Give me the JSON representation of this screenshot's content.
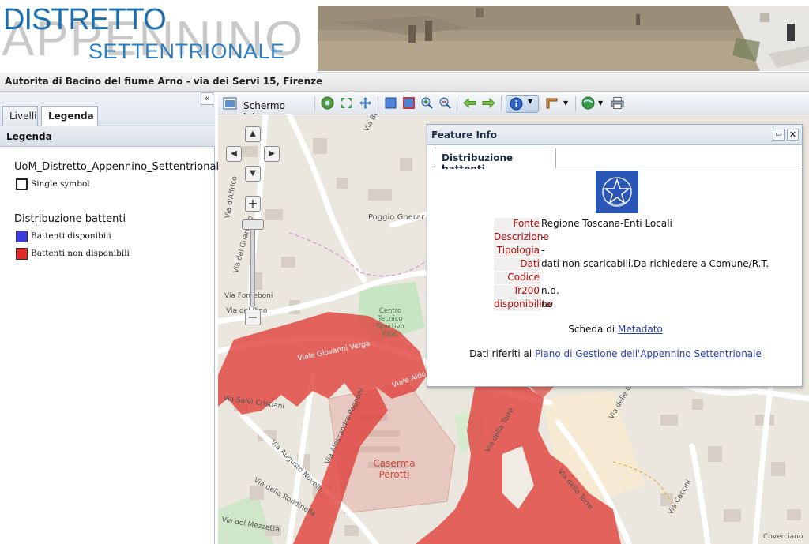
{
  "banner": {
    "logo_line1": "DISTRETTO",
    "logo_line2": "APPENNINO",
    "logo_line3": "SETTENTRIONALE"
  },
  "authority": {
    "text": "Autorita di Bacino del fiume Arno - via dei Servi 15, Firenze"
  },
  "left_panel": {
    "collapse_icon": "«",
    "tabs": [
      {
        "label": "Livelli",
        "active": false
      },
      {
        "label": "Legenda",
        "active": true
      }
    ],
    "header": "Legenda",
    "legend": [
      {
        "title": "UoM_Distretto_Appennino_Settentrionale",
        "items": [
          {
            "label": "Single symbol",
            "color": "#ffffff"
          }
        ]
      },
      {
        "title": "Distribuzione battenti",
        "items": [
          {
            "label": "Battenti disponibili",
            "color": "#3b3be0"
          },
          {
            "label": "Battenti non disponibili",
            "color": "#e02a2a"
          }
        ]
      }
    ]
  },
  "toolbar": {
    "full_extent_label": "Schermo Intero",
    "icons": [
      "full-extent-icon",
      "globe-zoom-icon",
      "zoom-extent-icon",
      "pan-icon",
      "zoom-box-in-icon",
      "zoom-box-out-icon",
      "zoom-in-icon",
      "zoom-out-icon",
      "previous-extent-icon",
      "next-extent-icon",
      "identify-info-icon",
      "measure-icon",
      "layers-globe-icon",
      "print-icon"
    ]
  },
  "map": {
    "labels": [
      "Poggio Gherar",
      "Centro Tecnico Sportivo FIGC",
      "Viale Giovanni Verga",
      "Viale Aldo Palazzeschi",
      "Via Salvi Cristiani",
      "Via Alessandro Pagnoni",
      "Via Augusto Novelli",
      "Via della Rondinella",
      "Via del Mezzetta",
      "Caserma Perotti",
      "Via della Torre",
      "Via della Torre",
      "Via delle Grazie",
      "Via Caccini",
      "Coverciano",
      "Via Fonteboni",
      "Via del Pino",
      "Via d'Affrico",
      "Via del Guarlone",
      "Via Be"
    ],
    "nav_icons": {
      "up": "▲",
      "down": "▼",
      "left": "◀",
      "right": "▶",
      "zoom_in": "+",
      "zoom_out": "−"
    }
  },
  "feature_info": {
    "title": "Feature Info",
    "pin_icon": "▭",
    "close_icon": "✕",
    "tab": "Distribuzione battenti",
    "rows": [
      {
        "key": "Fonte",
        "value": "Regione Toscana-Enti Locali"
      },
      {
        "key": "Descrizione",
        "value": "-"
      },
      {
        "key": "Tipologia",
        "value": "-"
      },
      {
        "key": "Dati",
        "value": "dati non scaricabili.Da richiedere a Comune/R.T."
      },
      {
        "key": "Codice",
        "value": ""
      },
      {
        "key": "Tr200",
        "value": "n.d."
      },
      {
        "key": "disponibilita",
        "value": "no"
      }
    ],
    "scheda_prefix": "Scheda di",
    "scheda_link": "Metadato",
    "dati_prefix": "Dati riferiti al",
    "dati_link": "Piano di Gestione dell'Appennino Settentrionale"
  }
}
